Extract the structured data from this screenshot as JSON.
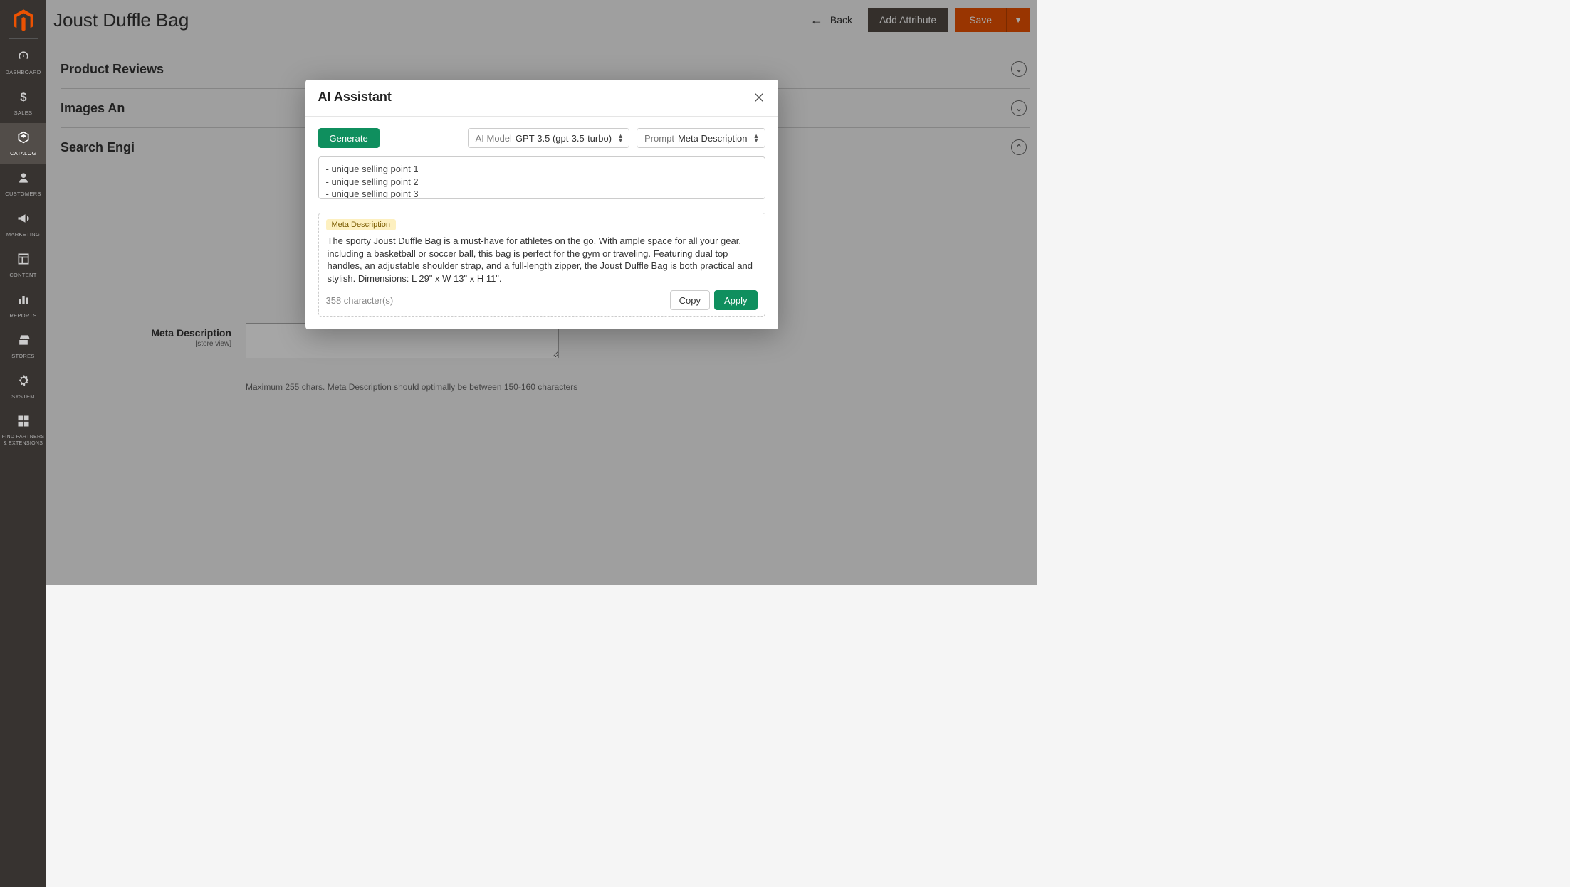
{
  "sidebar": {
    "items": [
      {
        "label": "DASHBOARD",
        "icon": "gauge"
      },
      {
        "label": "SALES",
        "icon": "dollar"
      },
      {
        "label": "CATALOG",
        "icon": "box",
        "active": true
      },
      {
        "label": "CUSTOMERS",
        "icon": "person"
      },
      {
        "label": "MARKETING",
        "icon": "megaphone"
      },
      {
        "label": "CONTENT",
        "icon": "layout"
      },
      {
        "label": "REPORTS",
        "icon": "bars"
      },
      {
        "label": "STORES",
        "icon": "storefront"
      },
      {
        "label": "SYSTEM",
        "icon": "gear"
      },
      {
        "label": "FIND PARTNERS\n& EXTENSIONS",
        "icon": "blocks"
      }
    ]
  },
  "header": {
    "page_title": "Joust Duffle Bag",
    "back": "Back",
    "add_attribute": "Add Attribute",
    "save": "Save"
  },
  "sections": {
    "product_reviews": "Product Reviews",
    "images_and_videos": "Images An",
    "search_engine_optimization": "Search Engi"
  },
  "seo": {
    "meta_description_label": "Meta Description",
    "scope": "[store view]",
    "hint": "Maximum 255 chars. Meta Description should optimally be between 150-160 characters"
  },
  "modal": {
    "title": "AI Assistant",
    "generate": "Generate",
    "model_prefix": "AI Model",
    "model_value": "GPT-3.5 (gpt-3.5-turbo)",
    "prompt_prefix": "Prompt",
    "prompt_value": "Meta Description",
    "usp_text": "- unique selling point 1\n- unique selling point 2\n- unique selling point 3",
    "result_tag": "Meta Description",
    "result_text": "The sporty Joust Duffle Bag is a must-have for athletes on the go. With ample space for all your gear, including a basketball or soccer ball, this bag is perfect for the gym or traveling. Featuring dual top handles, an adjustable shoulder strap, and a full-length zipper, the Joust Duffle Bag is both practical and stylish. Dimensions: L 29\" x W 13\" x H 11\".",
    "char_count": "358 character(s)",
    "copy": "Copy",
    "apply": "Apply"
  }
}
